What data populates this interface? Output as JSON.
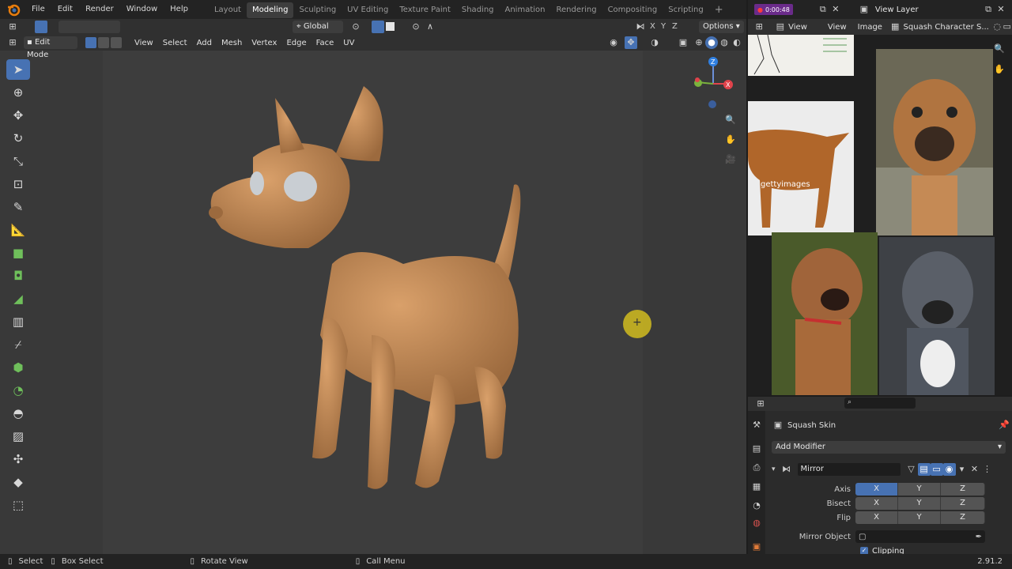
{
  "menus": [
    "File",
    "Edit",
    "Render",
    "Window",
    "Help"
  ],
  "workspaces": [
    "Layout",
    "Modeling",
    "Sculpting",
    "UV Editing",
    "Texture Paint",
    "Shading",
    "Animation",
    "Rendering",
    "Compositing",
    "Scripting"
  ],
  "active_workspace": "Modeling",
  "add_tab": "+",
  "top_right": {
    "record_time": "0:00:48",
    "view_layer": "View Layer"
  },
  "header2": {
    "transform_orientation": "Global",
    "options": "Options",
    "axes": [
      "X",
      "Y",
      "Z"
    ]
  },
  "viewport_header": {
    "mode": "Edit Mode",
    "menus": [
      "View",
      "Select",
      "Add",
      "Mesh",
      "Vertex",
      "Edge",
      "Face",
      "UV"
    ]
  },
  "image_editor": {
    "menus": [
      "View",
      "View",
      "Image"
    ],
    "image_name": "Squash Character S...",
    "watermark": "gettyimages"
  },
  "properties": {
    "object_name": "Squash Skin",
    "add_modifier": "Add Modifier",
    "modifier_name": "Mirror",
    "rows": {
      "axis": "Axis",
      "bisect": "Bisect",
      "flip": "Flip",
      "mirror_object": "Mirror Object",
      "clipping": "Clipping"
    },
    "xyz": [
      "X",
      "Y",
      "Z"
    ]
  },
  "status": {
    "select": "Select",
    "box_select": "Box Select",
    "rotate_view": "Rotate View",
    "call_menu": "Call Menu",
    "version": "2.91.2"
  },
  "colors": {
    "accent": "#4772b3",
    "model": "#c48a55"
  }
}
